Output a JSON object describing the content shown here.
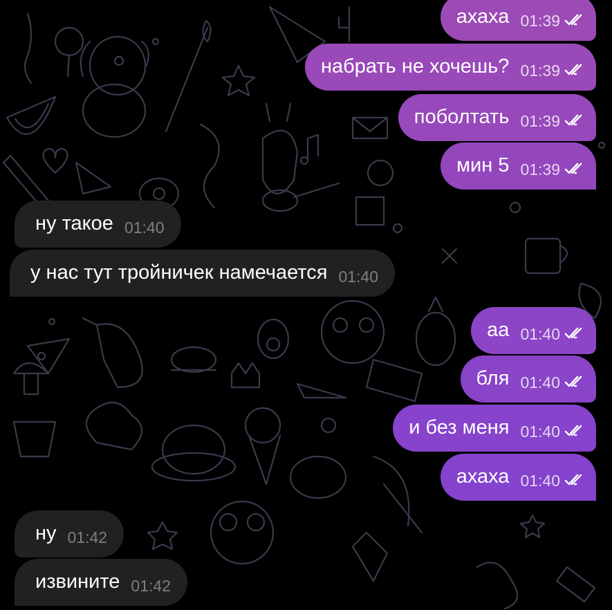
{
  "theme": {
    "background": "#000000",
    "doodle_color": "#3a3a4c",
    "incoming_bubble": "#212121",
    "outgoing_top": "#9d4ab5",
    "outgoing_bottom": "#7d40d4"
  },
  "messages": [
    {
      "dir": "out",
      "text": "ахаха",
      "time": "01:39",
      "status": "read-double-check-icon"
    },
    {
      "dir": "out",
      "text": "набрать не хочешь?",
      "time": "01:39",
      "status": "read-double-check-icon"
    },
    {
      "dir": "out",
      "text": "поболтать",
      "time": "01:39",
      "status": "read-double-check-icon"
    },
    {
      "dir": "out",
      "text": "мин 5",
      "time": "01:39",
      "status": "read-double-check-icon"
    },
    {
      "dir": "in",
      "text": "ну такое",
      "time": "01:40"
    },
    {
      "dir": "in",
      "text": "у нас тут тройничек намечается",
      "time": "01:40"
    },
    {
      "dir": "out",
      "text": "аа",
      "time": "01:40",
      "status": "read-double-check-icon"
    },
    {
      "dir": "out",
      "text": "бля",
      "time": "01:40",
      "status": "read-double-check-icon"
    },
    {
      "dir": "out",
      "text": "и без меня",
      "time": "01:40",
      "status": "read-double-check-icon"
    },
    {
      "dir": "out",
      "text": "ахаха",
      "time": "01:40",
      "status": "read-double-check-icon"
    },
    {
      "dir": "in",
      "text": "ну",
      "time": "01:42"
    },
    {
      "dir": "in",
      "text": "извините",
      "time": "01:42"
    }
  ]
}
